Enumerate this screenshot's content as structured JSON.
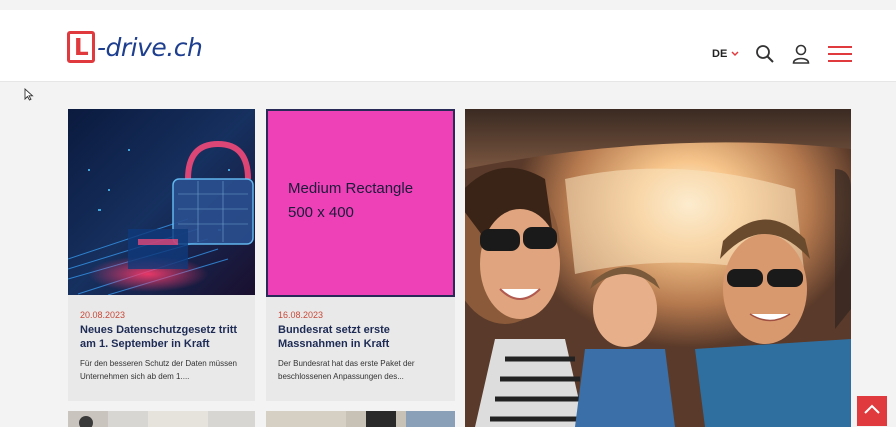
{
  "header": {
    "logo_letter": "L",
    "logo_text": "-drive.ch",
    "language": "DE"
  },
  "cards": [
    {
      "date": "20.08.2023",
      "title": "Neues Datenschutzgesetz tritt am 1. September in Kraft",
      "description": "Für den besseren Schutz der Daten müssen Unternehmen sich ab dem 1...."
    },
    {
      "date": "16.08.2023",
      "title": "Bundesrat setzt erste Massnahmen in Kraft",
      "description": "Der Bundesrat hat das erste Paket der beschlossenen Anpassungen des..."
    }
  ],
  "ad": {
    "line1": "Medium Rectangle",
    "line2": "500 x 400"
  },
  "icons": {
    "search": "search-icon",
    "user": "user-icon",
    "menu": "hamburger-menu-icon",
    "scroll_top": "chevron-up-icon"
  },
  "colors": {
    "brand_red": "#e03a3e",
    "brand_blue": "#1e3f8f",
    "ad_pink": "#ee41b8",
    "date_red": "#c74a3a",
    "title_navy": "#1d2b55"
  }
}
